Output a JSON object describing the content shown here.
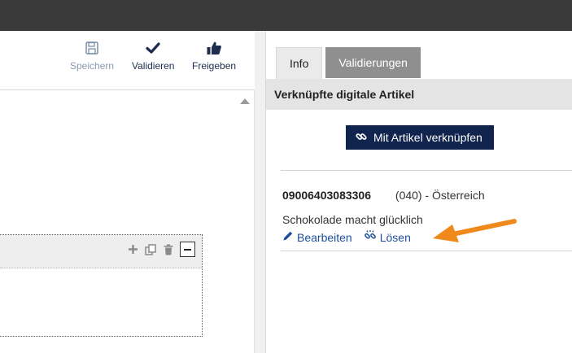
{
  "toolbar": {
    "save_label": "Speichern",
    "validate_label": "Validieren",
    "release_label": "Freigeben"
  },
  "right": {
    "tabs": [
      {
        "label": "Info",
        "active": true
      },
      {
        "label": "Validierungen",
        "active": false
      }
    ],
    "section_title": "Verknüpfte digitale Artikel",
    "link_button_label": "Mit Artikel verknüpfen",
    "entry": {
      "code": "09006403083306",
      "country": "(040) - Österreich",
      "description": "Schokolade macht glücklich",
      "edit_label": "Bearbeiten",
      "unlink_label": "Lösen"
    }
  },
  "colors": {
    "topbar": "#3a3a3a",
    "navy_button": "#10244d",
    "link": "#1d4f9c",
    "tab_inactive": "#8f8f8f",
    "annotation_arrow": "#f0891c"
  },
  "icons": [
    "save-icon",
    "check-icon",
    "thumbs-up-icon",
    "scroll-up-icon",
    "plus-icon",
    "copy-icon",
    "trash-icon",
    "minus-icon",
    "link-icon",
    "pencil-icon",
    "unlink-icon",
    "annotation-arrow"
  ]
}
